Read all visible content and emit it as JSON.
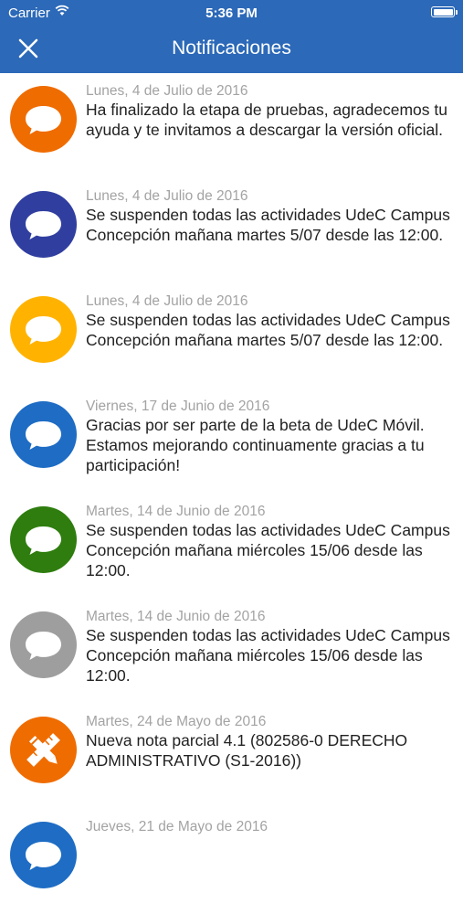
{
  "status_bar": {
    "carrier": "Carrier",
    "time": "5:36 PM"
  },
  "header": {
    "title": "Notificaciones",
    "close_icon": "close-icon"
  },
  "notifications": [
    {
      "date": "Lunes, 4 de Julio de 2016",
      "message": "Ha finalizado la etapa de pruebas, agradecemos tu ayuda y te invitamos a descargar la versión oficial.",
      "color": "#ef6c00",
      "icon": "chat-bubble-icon"
    },
    {
      "date": "Lunes, 4 de Julio de 2016",
      "message": "Se suspenden todas las actividades UdeC Campus Concepción mañana martes 5/07 desde las 12:00.",
      "color": "#303f9f",
      "icon": "chat-bubble-icon"
    },
    {
      "date": "Lunes, 4 de Julio de 2016",
      "message": "Se suspenden todas las actividades UdeC Campus Concepción mañana martes 5/07 desde las 12:00.",
      "color": "#ffb300",
      "icon": "chat-bubble-icon"
    },
    {
      "date": "Viernes, 17 de Junio de 2016",
      "message": "Gracias por ser parte de la beta de UdeC Móvil. Estamos mejorando continuamente gracias a tu participación!",
      "color": "#1e6cc4",
      "icon": "chat-bubble-icon"
    },
    {
      "date": "Martes, 14 de Junio de 2016",
      "message": "Se suspenden todas las actividades UdeC Campus Concepción mañana miércoles 15/06 desde las 12:00.",
      "color": "#2e7d0e",
      "icon": "chat-bubble-icon"
    },
    {
      "date": "Martes, 14 de Junio de 2016",
      "message": "Se suspenden todas las actividades UdeC Campus Concepción mañana miércoles 15/06 desde las 12:00.",
      "color": "#9e9e9e",
      "icon": "chat-bubble-icon"
    },
    {
      "date": "Martes, 24 de Mayo de 2016",
      "message": "Nueva nota parcial 4.1 (802586-0 DERECHO ADMINISTRATIVO (S1-2016))",
      "color": "#ef6c00",
      "icon": "grade-pencil-ruler-icon"
    },
    {
      "date": "Jueves, 21 de Mayo de 2016",
      "message": "",
      "color": "#1e6cc4",
      "icon": "chat-bubble-icon"
    }
  ]
}
